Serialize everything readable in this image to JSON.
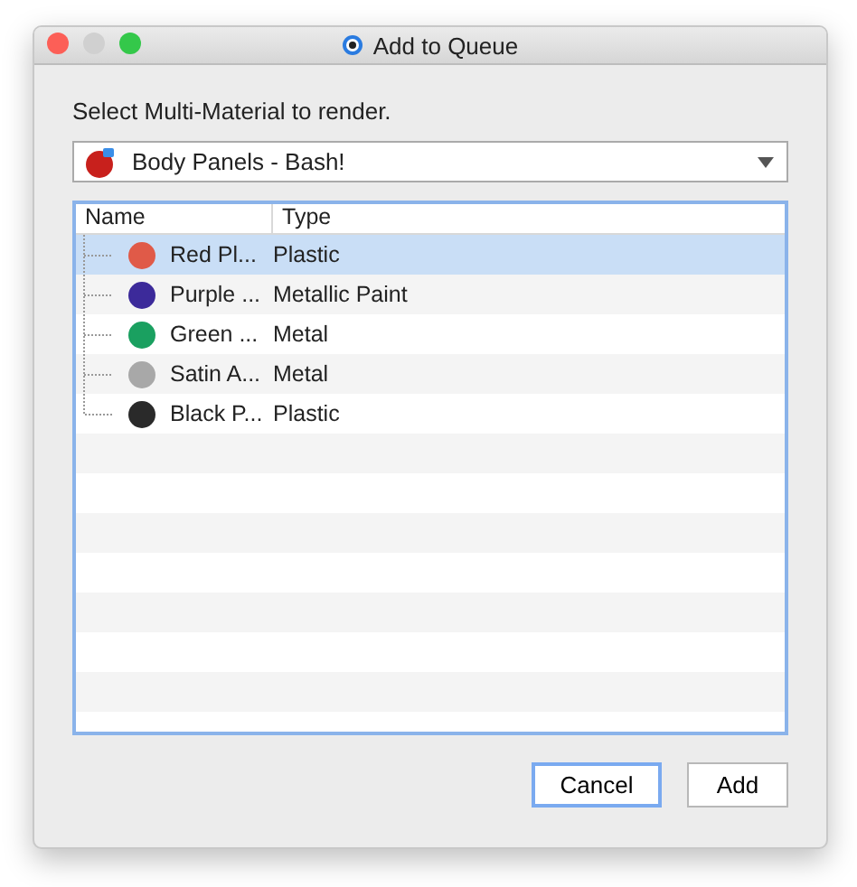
{
  "window": {
    "title": "Add to Queue"
  },
  "prompt": "Select Multi-Material to render.",
  "dropdown": {
    "value": "Body Panels - Bash!"
  },
  "table": {
    "columns": [
      "Name",
      "Type"
    ],
    "rows": [
      {
        "name": "Red Pl...",
        "type": "Plastic",
        "color": "#e05a48",
        "selected": true
      },
      {
        "name": "Purple ...",
        "type": "Metallic Paint",
        "color": "#3c2a9a",
        "selected": false
      },
      {
        "name": "Green ...",
        "type": "Metal",
        "color": "#1aa060",
        "selected": false
      },
      {
        "name": "Satin A...",
        "type": "Metal",
        "color": "#a8a8a8",
        "selected": false
      },
      {
        "name": "Black P...",
        "type": "Plastic",
        "color": "#2a2a2a",
        "selected": false
      }
    ]
  },
  "buttons": [
    {
      "label": "Cancel",
      "kind": "focused"
    },
    {
      "label": "Add",
      "kind": "plain"
    }
  ]
}
